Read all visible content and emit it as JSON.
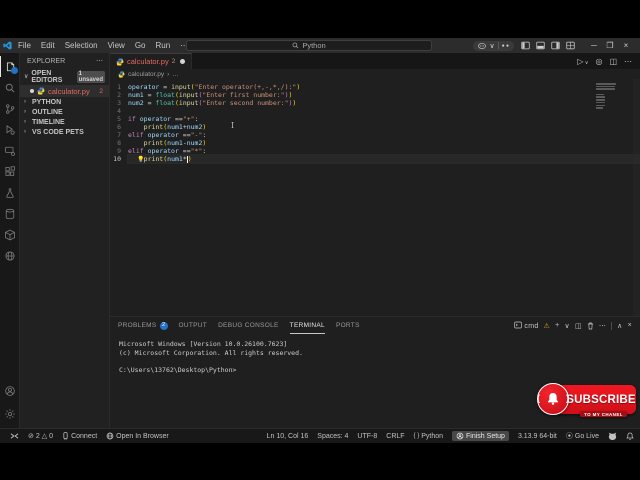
{
  "titlebar": {
    "menus": [
      "File",
      "Edit",
      "Selection",
      "View",
      "Go",
      "Run",
      "⋯"
    ],
    "back_arrow": "←",
    "forward_arrow": "→",
    "search_label": "Python",
    "copilot_dots": "● ●",
    "minimize": "─",
    "maximize": "❐",
    "close": "×"
  },
  "explorer": {
    "title": "EXPLORER",
    "more": "⋯",
    "open_editors_label": "OPEN EDITORS",
    "unsaved_badge": "1 unsaved",
    "file_name": "calculator.py",
    "file_problem_count": "2",
    "sections": [
      {
        "label": "PYTHON"
      },
      {
        "label": "OUTLINE"
      },
      {
        "label": "TIMELINE"
      },
      {
        "label": "VS CODE PETS"
      }
    ]
  },
  "tab": {
    "name": "calculator.py",
    "problem_count": "2"
  },
  "editor_actions": {
    "run": "▷",
    "run_chevron": "∨",
    "config": "◎",
    "split": "◫",
    "more": "⋯"
  },
  "breadcrumb": {
    "file": "calculator.py",
    "separator": "›",
    "more": "…"
  },
  "code": {
    "lines": [
      {
        "n": "1",
        "tokens": [
          [
            "v",
            "operator"
          ],
          [
            "o",
            " = "
          ],
          [
            "f",
            "input"
          ],
          [
            "b1",
            "("
          ],
          [
            "s",
            "\"Enter operator(+,-,*,/):\""
          ],
          [
            "b1",
            ")"
          ]
        ]
      },
      {
        "n": "2",
        "tokens": [
          [
            "v",
            "num1"
          ],
          [
            "o",
            " = "
          ],
          [
            "t",
            "float"
          ],
          [
            "b1",
            "("
          ],
          [
            "f",
            "input"
          ],
          [
            "b2",
            "("
          ],
          [
            "s",
            "\"Enter first number:\""
          ],
          [
            "b2",
            ")"
          ],
          [
            "b1",
            ")"
          ]
        ]
      },
      {
        "n": "3",
        "tokens": [
          [
            "v",
            "num2"
          ],
          [
            "o",
            " = "
          ],
          [
            "t",
            "float"
          ],
          [
            "b1",
            "("
          ],
          [
            "f",
            "input"
          ],
          [
            "b2",
            "("
          ],
          [
            "s",
            "\"Enter second number:\""
          ],
          [
            "b2",
            ")"
          ],
          [
            "b1",
            ")"
          ]
        ]
      },
      {
        "n": "4",
        "tokens": []
      },
      {
        "n": "5",
        "tokens": [
          [
            "k",
            "if"
          ],
          [
            "o",
            " "
          ],
          [
            "v",
            "operator"
          ],
          [
            "o",
            " =="
          ],
          [
            "s",
            "\"+\""
          ],
          [
            "o",
            ":"
          ]
        ]
      },
      {
        "n": "6",
        "tokens": [
          [
            "o",
            "    "
          ],
          [
            "f",
            "print"
          ],
          [
            "b1",
            "("
          ],
          [
            "v",
            "num1"
          ],
          [
            "o",
            "+"
          ],
          [
            "v",
            "num2"
          ],
          [
            "b1",
            ")"
          ]
        ]
      },
      {
        "n": "7",
        "tokens": [
          [
            "k",
            "elif"
          ],
          [
            "o",
            " "
          ],
          [
            "v",
            "operator"
          ],
          [
            "o",
            " =="
          ],
          [
            "s",
            "\"-\""
          ],
          [
            "o",
            ":"
          ]
        ]
      },
      {
        "n": "8",
        "tokens": [
          [
            "o",
            "    "
          ],
          [
            "f",
            "print"
          ],
          [
            "b1",
            "("
          ],
          [
            "v",
            "num1"
          ],
          [
            "o",
            "-"
          ],
          [
            "v",
            "num2"
          ],
          [
            "b1",
            ")"
          ]
        ]
      },
      {
        "n": "9",
        "tokens": [
          [
            "k",
            "elif"
          ],
          [
            "o",
            " "
          ],
          [
            "v",
            "operator"
          ],
          [
            "o",
            " =="
          ],
          [
            "s",
            "\"*\""
          ],
          [
            "o",
            ":"
          ]
        ]
      },
      {
        "n": "10",
        "tokens": [
          [
            "o",
            "    "
          ],
          [
            "f",
            "print"
          ],
          [
            "b1",
            "("
          ],
          [
            "v",
            "num1"
          ],
          [
            "o",
            "*"
          ],
          [
            "cur",
            ""
          ],
          [
            "b1",
            ")"
          ]
        ],
        "active": true,
        "lightbulb": true
      }
    ]
  },
  "panel": {
    "tabs": [
      {
        "label": "PROBLEMS",
        "badge": "2"
      },
      {
        "label": "OUTPUT"
      },
      {
        "label": "DEBUG CONSOLE"
      },
      {
        "label": "TERMINAL",
        "active": true
      },
      {
        "label": "PORTS"
      }
    ],
    "profile_label": "cmd",
    "actions": {
      "warning": "⚠",
      "new": "+",
      "chevron": "∨",
      "split": "◫",
      "kebab": "⋯",
      "maximize": "∧",
      "close": "×"
    },
    "terminal_lines": [
      "Microsoft Windows [Version 10.0.26100.7623]",
      "(c) Microsoft Corporation. All rights reserved.",
      "",
      "C:\\Users\\13762\\Desktop\\Python>"
    ]
  },
  "statusbar": {
    "errors": "2",
    "warnings": "0",
    "error_glyph": "⊘",
    "warning_glyph": "△",
    "connect": "Connect",
    "open_in_browser": "Open In Browser",
    "cursor_position": "Ln 10, Col 16",
    "spaces": "Spaces: 4",
    "encoding": "UTF-8",
    "eol": "CRLF",
    "language_glyph": "{ }",
    "language": "Python",
    "finish_setup": "Finish Setup",
    "interpreter": "3.13.9 64-bit",
    "go_live_glyph": "⦿",
    "go_live": "Go Live"
  },
  "subscribe": {
    "title": "SUBSCRIBE",
    "subtitle": "TO MY CHANEL"
  },
  "colors": {
    "badge-blue": "#2472c8",
    "tab-red": "#e5695e",
    "sub-red": "#e8171f",
    "sub-red-dark": "#a50d12"
  },
  "syntax_colors": {
    "variable": "#9CDCFE",
    "function": "#DCDCAA",
    "builtin_type": "#4EC9B0",
    "keyword": "#C586C0",
    "string": "#CE9178",
    "bracket1": "#FFD700",
    "bracket2": "#DA70D6"
  }
}
